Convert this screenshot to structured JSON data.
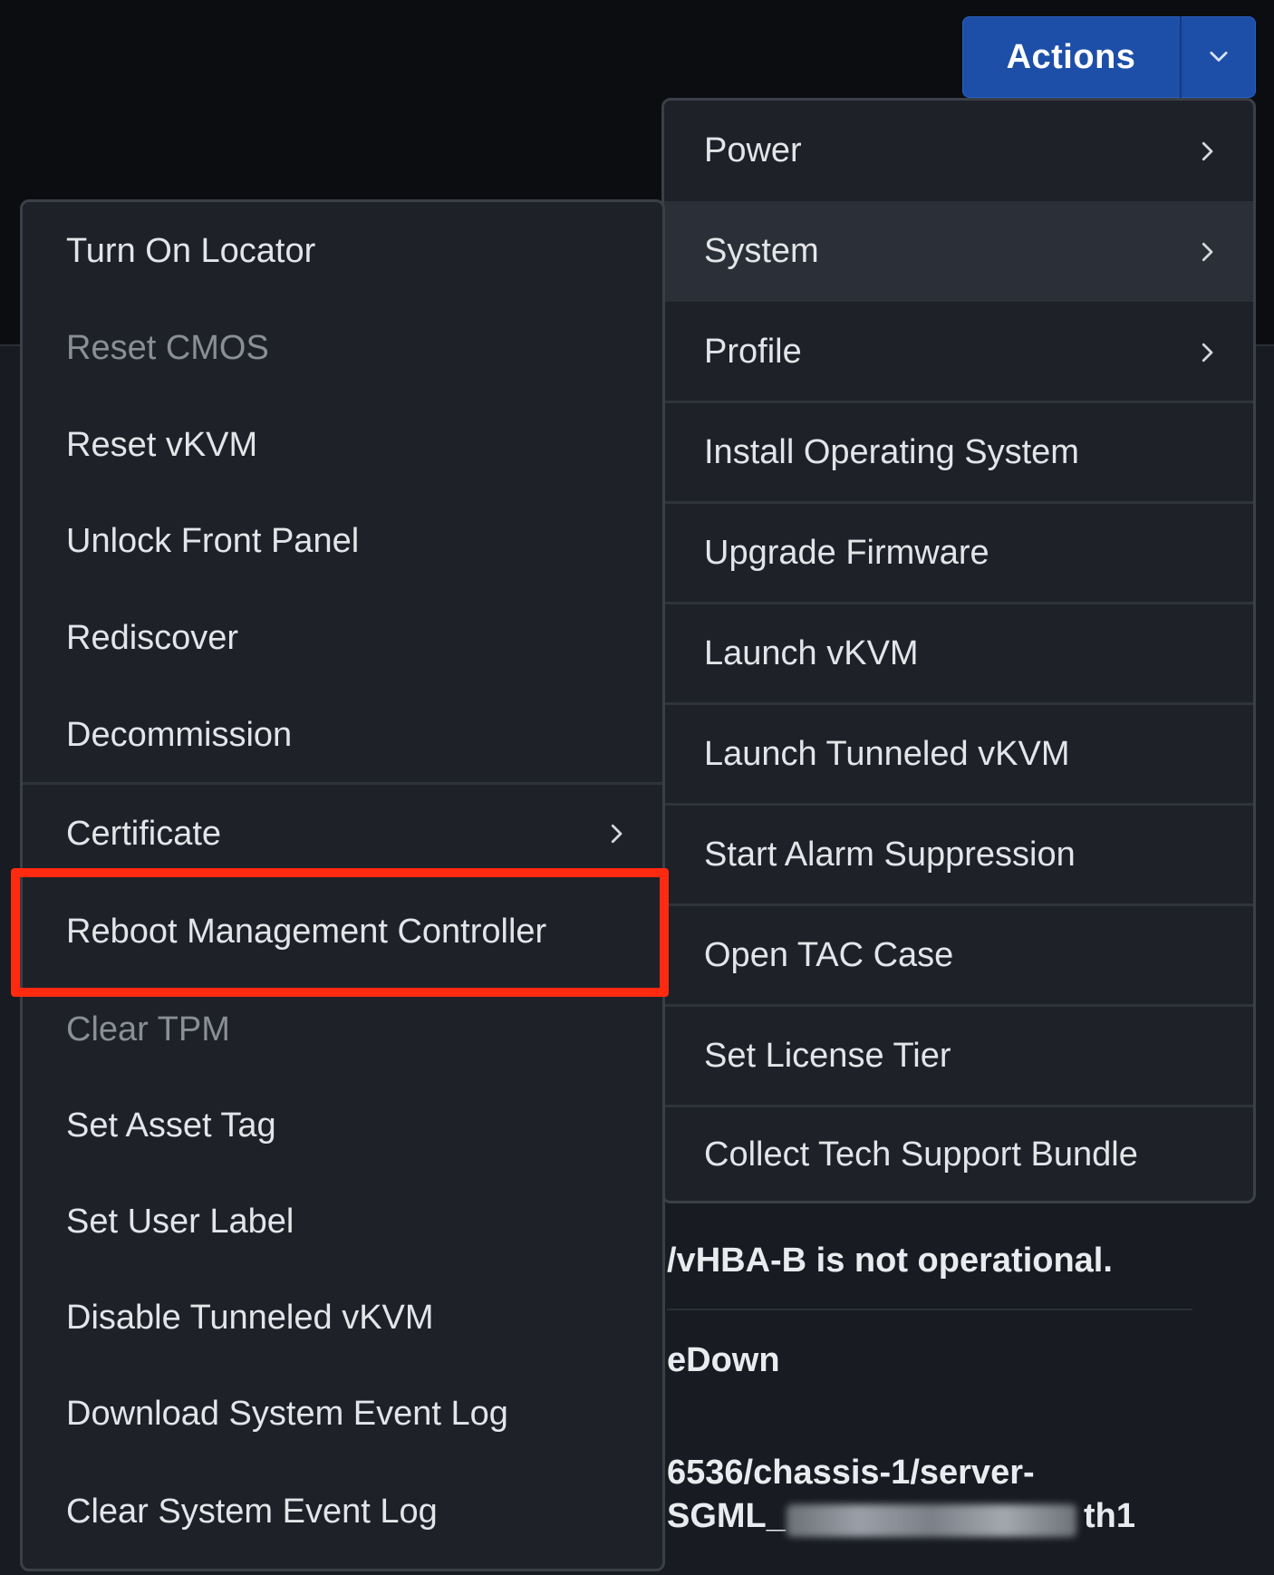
{
  "actions_button": {
    "label": "Actions",
    "dropdown_icon": "chevron-down-icon"
  },
  "main_menu": {
    "items": [
      {
        "label": "Power",
        "has_submenu": true
      },
      {
        "label": "System",
        "has_submenu": true,
        "active": true
      },
      {
        "label": "Profile",
        "has_submenu": true
      },
      {
        "label": "Install Operating System"
      },
      {
        "label": "Upgrade Firmware"
      },
      {
        "label": "Launch vKVM"
      },
      {
        "label": "Launch Tunneled vKVM"
      },
      {
        "label": "Start Alarm Suppression"
      },
      {
        "label": "Open TAC Case"
      },
      {
        "label": "Set License Tier"
      },
      {
        "label": "Collect Tech Support Bundle"
      }
    ]
  },
  "system_submenu": {
    "items": [
      {
        "label": "Turn On Locator"
      },
      {
        "label": "Reset CMOS",
        "disabled": true
      },
      {
        "label": "Reset vKVM"
      },
      {
        "label": "Unlock Front Panel"
      },
      {
        "label": "Rediscover"
      },
      {
        "label": "Decommission"
      },
      {
        "label": "Certificate",
        "has_submenu": true
      },
      {
        "label": "Reboot Management Controller",
        "highlighted": true
      },
      {
        "label": "Clear TPM",
        "disabled": true
      },
      {
        "label": "Set Asset Tag"
      },
      {
        "label": "Set User Label"
      },
      {
        "label": "Disable Tunneled vKVM"
      },
      {
        "label": "Download System Event Log"
      },
      {
        "label": "Clear System Event Log"
      }
    ]
  },
  "background": {
    "alert_fragment": "/vHBA-B is not operational.",
    "state_fragment": "eDown",
    "path_fragment_1": "6536/chassis-1/server-",
    "path_fragment_2_prefix": "SGML_",
    "path_fragment_2_suffix": "th1"
  },
  "colors": {
    "highlight_border": "#ff2a10",
    "actions_button": "#1d4fa8",
    "menu_bg": "#1e2128"
  }
}
